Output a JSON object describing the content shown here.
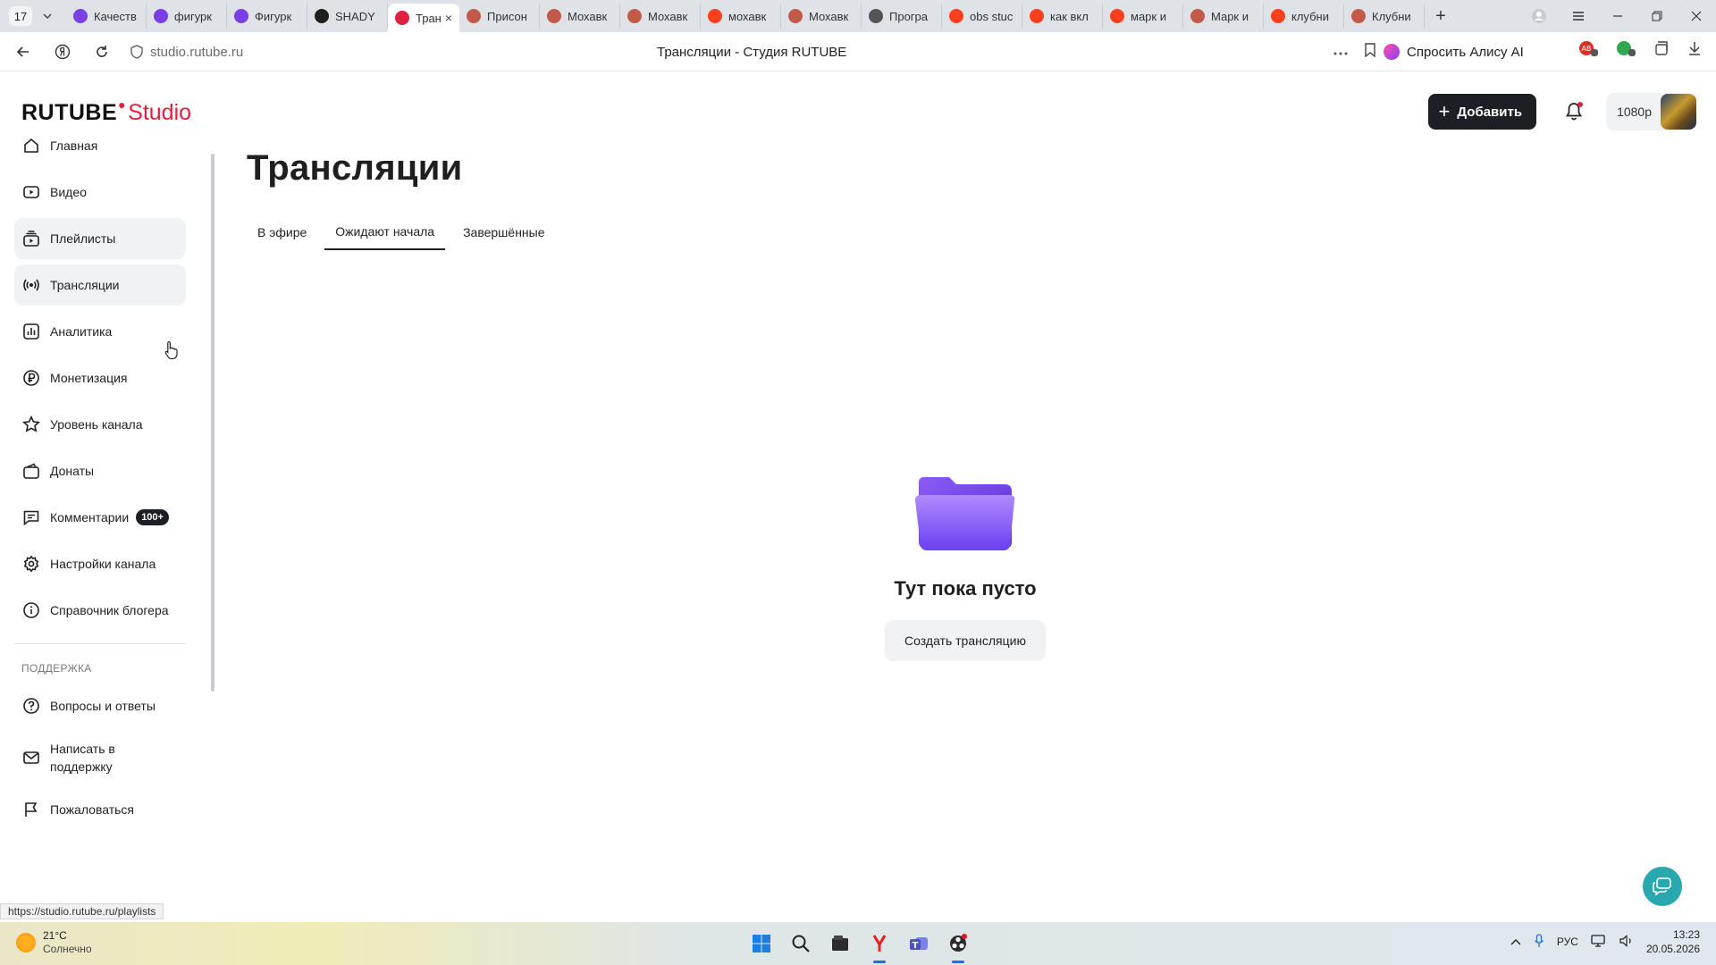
{
  "browser": {
    "tab_count": "17",
    "tabs": [
      {
        "label": "Качеств",
        "icon": "purple-circle-icon",
        "color": "#7b3fe4"
      },
      {
        "label": "фигурк",
        "icon": "purple-circle-icon",
        "color": "#7b3fe4"
      },
      {
        "label": "Фигурк",
        "icon": "purple-circle-icon",
        "color": "#7b3fe4"
      },
      {
        "label": "SHADY",
        "icon": "rutube-r-icon",
        "color": "#1f1f1f"
      },
      {
        "label": "Тран",
        "icon": "rutube-studio-icon",
        "color": "#e0203e",
        "active": true
      },
      {
        "label": "Присон",
        "icon": "avatar-icon",
        "color": "#c25a4a"
      },
      {
        "label": "Мохавк",
        "icon": "avatar-icon",
        "color": "#c25a4a"
      },
      {
        "label": "Мохавк",
        "icon": "avatar-icon",
        "color": "#c25a4a"
      },
      {
        "label": "мохавк",
        "icon": "yandex-icon",
        "color": "#fc3f1d"
      },
      {
        "label": "Мохавк",
        "icon": "avatar-icon",
        "color": "#c25a4a"
      },
      {
        "label": "Програ",
        "icon": "house-icon",
        "color": "#555555"
      },
      {
        "label": "obs stuc",
        "icon": "yandex-icon",
        "color": "#fc3f1d"
      },
      {
        "label": "как вкл",
        "icon": "yandex-icon",
        "color": "#fc3f1d"
      },
      {
        "label": "марк и",
        "icon": "yandex-icon",
        "color": "#fc3f1d"
      },
      {
        "label": "Марк и",
        "icon": "avatar-icon",
        "color": "#c25a4a"
      },
      {
        "label": "клубни",
        "icon": "yandex-icon",
        "color": "#fc3f1d"
      },
      {
        "label": "Клубни",
        "icon": "avatar-icon",
        "color": "#c25a4a"
      }
    ],
    "url_host": "studio.rutube.ru",
    "page_title": "Трансляции - Студия RUTUBE",
    "alice_label": "Спросить Алису AI",
    "status_url": "https://studio.rutube.ru/playlists"
  },
  "header": {
    "logo_main": "RUTUBE",
    "logo_studio": "Studio",
    "add_label": "Добавить",
    "quality": "1080p"
  },
  "sidebar": {
    "items": [
      {
        "label": "Главная",
        "icon": "home-icon"
      },
      {
        "label": "Видео",
        "icon": "video-icon"
      },
      {
        "label": "Плейлисты",
        "icon": "playlists-icon"
      },
      {
        "label": "Трансляции",
        "icon": "broadcast-icon"
      },
      {
        "label": "Аналитика",
        "icon": "analytics-icon"
      },
      {
        "label": "Монетизация",
        "icon": "ruble-icon"
      },
      {
        "label": "Уровень канала",
        "icon": "star-icon"
      },
      {
        "label": "Донаты",
        "icon": "donate-icon"
      },
      {
        "label": "Комментарии",
        "icon": "comment-icon",
        "badge": "100+"
      },
      {
        "label": "Настройки канала",
        "icon": "gear-icon"
      },
      {
        "label": "Справочник блогера",
        "icon": "info-icon"
      }
    ],
    "support_title": "ПОДДЕРЖКА",
    "support_items": [
      {
        "label": "Вопросы и ответы",
        "icon": "question-icon"
      },
      {
        "label": "Написать в поддержку",
        "icon": "mail-icon"
      },
      {
        "label": "Пожаловаться",
        "icon": "flag-icon"
      }
    ]
  },
  "main": {
    "title": "Трансляции",
    "tabs": [
      {
        "label": "В эфире"
      },
      {
        "label": "Ожидают начала",
        "active": true
      },
      {
        "label": "Завершённые"
      }
    ],
    "empty_title": "Тут пока пусто",
    "create_label": "Создать трансляцию"
  },
  "taskbar": {
    "temp": "21°C",
    "weather": "Солнечно",
    "lang": "РУС",
    "time": "13:23",
    "date": "20.05.2026"
  },
  "colors": {
    "brand_red": "#e0203e",
    "dark_button": "#1c1f24",
    "accent_teal": "#2aa8b0"
  }
}
